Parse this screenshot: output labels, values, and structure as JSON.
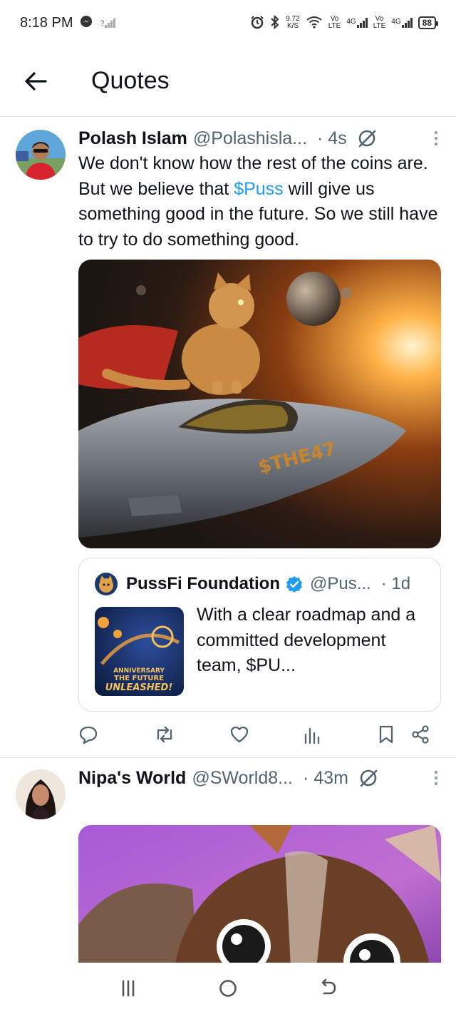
{
  "status_bar": {
    "time": "8:18 PM",
    "speed_value": "9.72",
    "speed_unit": "K/S",
    "sim1_label_top": "Vo",
    "sim1_label_bottom": "LTE",
    "sim1_net": "4G",
    "sim2_label_top": "Vo",
    "sim2_label_bottom": "LTE",
    "sim2_net": "4G",
    "battery": "88",
    "signal_unknown": "?"
  },
  "header": {
    "title": "Quotes"
  },
  "tweets": [
    {
      "author_name": "Polash Islam",
      "author_handle": "@Polashisla...",
      "time": "· 4s",
      "text_before": "We don't know how the rest of the coins are. But we believe that ",
      "cashtag": "$Puss",
      "text_after": " will give us something good in the future. So we still have to try to do something good.",
      "media_caption": "$THE47",
      "quote": {
        "author_name": "PussFi Foundation",
        "author_handle": "@Pus...",
        "time": "· 1d",
        "text": "With a clear roadmap and a committed development team, $PU...",
        "thumb_line1": "ANNIVERSARY",
        "thumb_line2": "THE FUTURE",
        "thumb_line3": "UNLEASHED!"
      }
    },
    {
      "author_name": "Nipa's World",
      "author_handle": "@SWorld8...",
      "time": "· 43m"
    }
  ],
  "colors": {
    "accent": "#1d9bf0",
    "text": "#0f1419",
    "secondary": "#536471",
    "divider": "#e6e6e6"
  }
}
